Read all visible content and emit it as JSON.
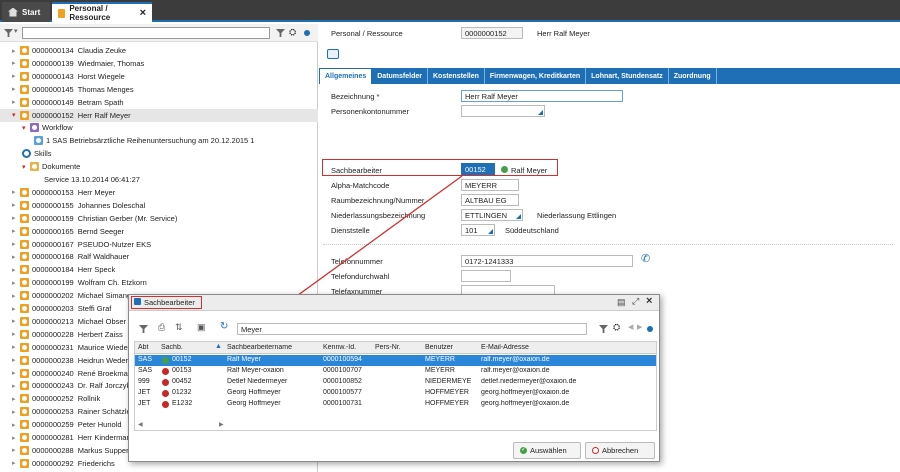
{
  "tabs": [
    {
      "label": "Start"
    },
    {
      "label": "Personal / Ressource"
    }
  ],
  "tree": [
    {
      "code": "0000000134",
      "name": "Claudia Zeuke"
    },
    {
      "code": "0000000139",
      "name": "Wiedmaier, Thomas"
    },
    {
      "code": "0000000143",
      "name": "Horst Wiegele"
    },
    {
      "code": "0000000145",
      "name": "Thomas Menges"
    },
    {
      "code": "0000000149",
      "name": "Betram Spath"
    },
    {
      "code": "0000000152",
      "name": "Herr Ralf Meyer"
    },
    {
      "label": "Workflow"
    },
    {
      "label": "1   SAS  Betriebsärztliche Reihenuntersuchung am 20.12.2015  1"
    },
    {
      "label": "Skills"
    },
    {
      "label": "Dokumente"
    },
    {
      "label": "Service  13.10.2014  06:41:27"
    },
    {
      "code": "0000000153",
      "name": "Herr Meyer"
    },
    {
      "code": "0000000155",
      "name": "Johannes Doleschal"
    },
    {
      "code": "0000000159",
      "name": "Christian Gerber (Mr. Service)"
    },
    {
      "code": "0000000165",
      "name": "Bernd Seeger"
    },
    {
      "code": "0000000167",
      "name": "PSEUDO-Nutzer EKS"
    },
    {
      "code": "0000000168",
      "name": "Ralf Waldhauer"
    },
    {
      "code": "0000000184",
      "name": "Herr Speck"
    },
    {
      "code": "0000000199",
      "name": "Wolfram Ch. Etzkorn"
    },
    {
      "code": "0000000202",
      "name": "Michael Simang"
    },
    {
      "code": "0000000203",
      "name": "Steffi Graf"
    },
    {
      "code": "0000000213",
      "name": "Michael Obser"
    },
    {
      "code": "0000000228",
      "name": "Herbert Zaiss"
    },
    {
      "code": "0000000231",
      "name": "Maurice Wiede"
    },
    {
      "code": "0000000238",
      "name": "Heidrun Weder"
    },
    {
      "code": "0000000240",
      "name": "René Broekmar"
    },
    {
      "code": "0000000243",
      "name": "Dr. Ralf Jorczyk"
    },
    {
      "code": "0000000252",
      "name": "Rollnik"
    },
    {
      "code": "0000000253",
      "name": "Rainer Schätzle"
    },
    {
      "code": "0000000259",
      "name": "Peter Hunold"
    },
    {
      "code": "0000000281",
      "name": "Herr Kinderman"
    },
    {
      "code": "0000000288",
      "name": "Markus Supper"
    },
    {
      "code": "0000000292",
      "name": "Friederichs"
    }
  ],
  "header": {
    "label": "Personal / Ressource",
    "id": "0000000152",
    "name": "Herr Ralf Meyer"
  },
  "detail_tabs": [
    "Allgemeines",
    "Datumsfelder",
    "Kostenstellen",
    "Firmenwagen, Kreditkarten",
    "Lohnart, Stundensatz",
    "Zuordnung"
  ],
  "form": {
    "bezeichnung_label": "Bezeichnung *",
    "bezeichnung_value": "Herr Ralf Meyer",
    "personenkonto_label": "Personenkontonummer",
    "sachbearbeiter_label": "Sachbearbeiter",
    "sachbearbeiter_value": "00152",
    "sachbearbeiter_name": "Ralf Meyer",
    "alpha_label": "Alpha-Matchcode",
    "alpha_value": "MEYERR",
    "raum_label": "Raumbezeichnung/Nummer",
    "raum_value": "ALTBAU EG",
    "nl_label": "Niederlassungsbezeichnung",
    "nl_value": "ETTLINGEN",
    "nl_desc": "Niederlassung Ettlingen",
    "dienst_label": "Dienststelle",
    "dienst_value": "101",
    "dienst_desc": "Süddeutschland",
    "tel_label": "Telefonnummer",
    "tel_value": "0172-1241333",
    "durchwahl_label": "Telefondurchwahl",
    "fax_label": "Telefaxnummer"
  },
  "dialog": {
    "title": "Sachbearbeiter",
    "search_value": "Meyer",
    "columns": [
      "Abt",
      "Sachb.",
      "Sachbearbeitername",
      "Kennw.-Id.",
      "Pers-Nr.",
      "Benutzer",
      "E-Mail-Adresse"
    ],
    "rows": [
      {
        "abt": "SAS",
        "sachb": "00152",
        "status": "green",
        "name": "Ralf Meyer",
        "kennw": "0000100594",
        "pers": "",
        "benutzer": "MEYERR",
        "email": "ralf.meyer@oxaion.de"
      },
      {
        "abt": "SAS",
        "sachb": "00153",
        "status": "red",
        "name": "Ralf Meyer-oxaion",
        "kennw": "0000100707",
        "pers": "",
        "benutzer": "MEYERR",
        "email": "ralf.meyer@oxaion.de"
      },
      {
        "abt": "999",
        "sachb": "00452",
        "status": "red",
        "name": "Detlef Niedermeyer",
        "kennw": "0000100852",
        "pers": "",
        "benutzer": "NIEDERMEYE",
        "email": "detlef.niedermeyer@oxaion.de"
      },
      {
        "abt": "JET",
        "sachb": "01232",
        "status": "red",
        "name": "Georg Hoffmeyer",
        "kennw": "0000100577",
        "pers": "",
        "benutzer": "HOFFMEYER",
        "email": "georg.hoffmeyer@oxaion.de"
      },
      {
        "abt": "JET",
        "sachb": "E1232",
        "status": "red",
        "name": "Georg Hoffmeyer",
        "kennw": "0000100731",
        "pers": "",
        "benutzer": "HOFFMEYER",
        "email": "georg.hoffmeyer@oxaion.de"
      }
    ],
    "select_label": "Auswählen",
    "cancel_label": "Abbrechen"
  },
  "colors": {
    "accent": "#1e6fb5",
    "highlight_red": "#d32f2f",
    "selected_row": "#2a86d8",
    "status_green": "#43a047",
    "status_red": "#c62828"
  }
}
